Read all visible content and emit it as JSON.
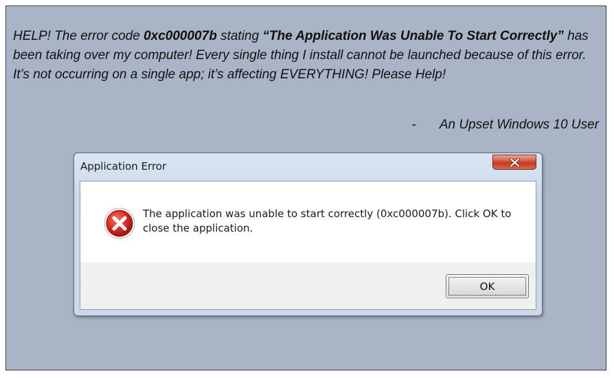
{
  "quote": {
    "part1": " HELP! The error code ",
    "code": "0xc000007b",
    "part2": " stating ",
    "message_quote": "“The Application Was Unable To Start Correctly”",
    "part3": " has been taking over my computer! Every single thing I install cannot be launched because of this error. It’s not occurring on a single app; it’s affecting EVERYTHING! Please Help!"
  },
  "signature": {
    "dash": "-",
    "author": "An Upset Windows 10 User"
  },
  "dialog": {
    "title": "Application Error",
    "message": "The application was unable to start correctly (0xc000007b). Click OK to close the application.",
    "ok_label": "OK",
    "icon": "error-icon",
    "close_icon": "close-icon"
  },
  "colors": {
    "background": "#a9b4c6",
    "error_red": "#d32f2f"
  }
}
